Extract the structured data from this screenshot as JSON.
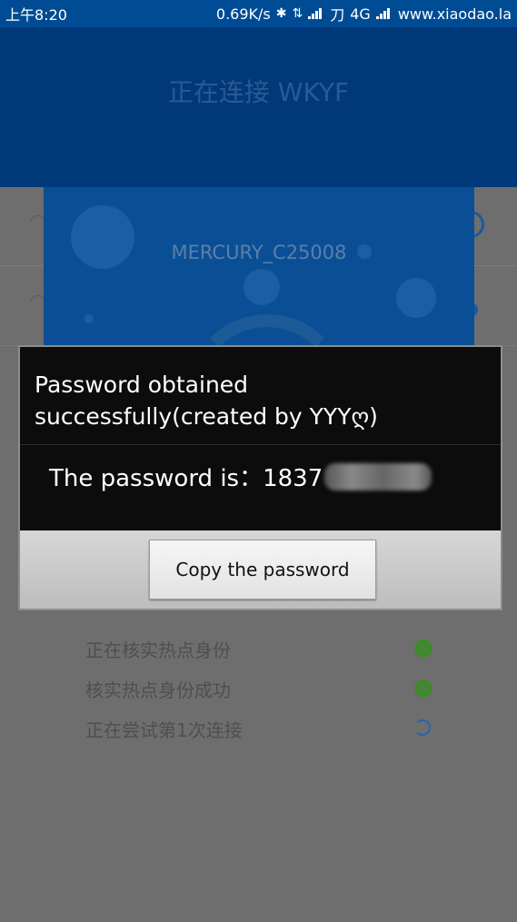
{
  "status_bar": {
    "time": "上午8:20",
    "speed": "0.69K/s",
    "network": "4G",
    "carrier_glyph": "刀",
    "watermark": "www.xiaodao.la",
    "icons": [
      "bluetooth-icon",
      "data-arrows-icon",
      "signal-icon",
      "signal-icon"
    ]
  },
  "header": {
    "title": "正在连接 WKYF"
  },
  "card": {
    "ssid": "MERCURY_C25008"
  },
  "dialog": {
    "title": "Password obtained successfully(created by YYYღ)",
    "message_prefix": "The password is：1837",
    "button_label": "Copy the password"
  },
  "steps": [
    {
      "label": "正在核实热点身份",
      "state": "done"
    },
    {
      "label": "核实热点身份成功",
      "state": "done"
    },
    {
      "label": "正在尝试第1次连接",
      "state": "loading"
    }
  ],
  "colors": {
    "header_blue": "#004c94",
    "card_blue": "#0a4f96",
    "dialog_bg": "#0c0c0c",
    "check_green": "#3f8a2d"
  }
}
